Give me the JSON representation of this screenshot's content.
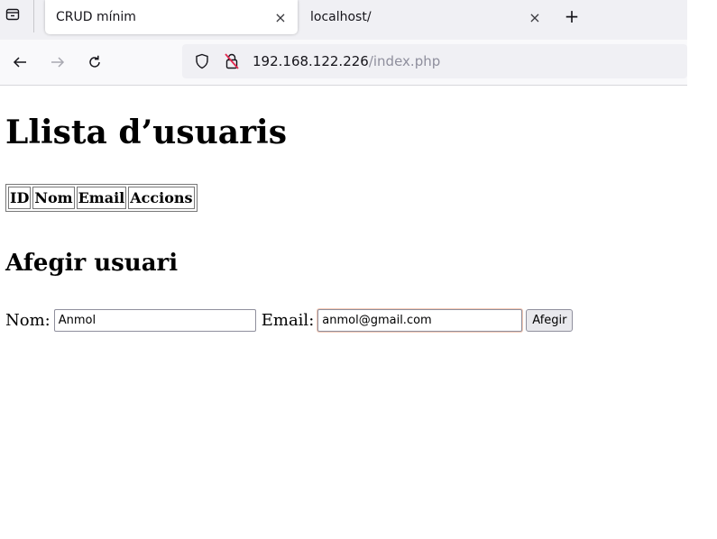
{
  "browser": {
    "tabs": [
      {
        "title": "CRUD mínim",
        "active": true
      },
      {
        "title": "localhost/",
        "active": false
      }
    ],
    "close_glyph": "×",
    "new_tab_glyph": "+",
    "url": {
      "host": "192.168.122.226",
      "path": "/index.php"
    },
    "icons": {
      "tab_list": "tab-list-icon",
      "back": "back-arrow-icon",
      "forward": "forward-arrow-icon",
      "reload": "reload-icon",
      "tracking_protection": "shield-icon",
      "insecure": "insecure-lock-icon"
    }
  },
  "page": {
    "title": "Llista d’usuaris",
    "table": {
      "headers": [
        "ID",
        "Nom",
        "Email",
        "Accions"
      ],
      "rows": []
    },
    "form": {
      "heading": "Afegir usuari",
      "nom_label": "Nom:",
      "nom_value": "Anmol",
      "email_label": "Email:",
      "email_value": "anmol@gmail.com",
      "submit_label": "Afegir"
    }
  },
  "colors": {
    "focus_ring": "#e6662e",
    "insecure_icon": "#e22850"
  }
}
